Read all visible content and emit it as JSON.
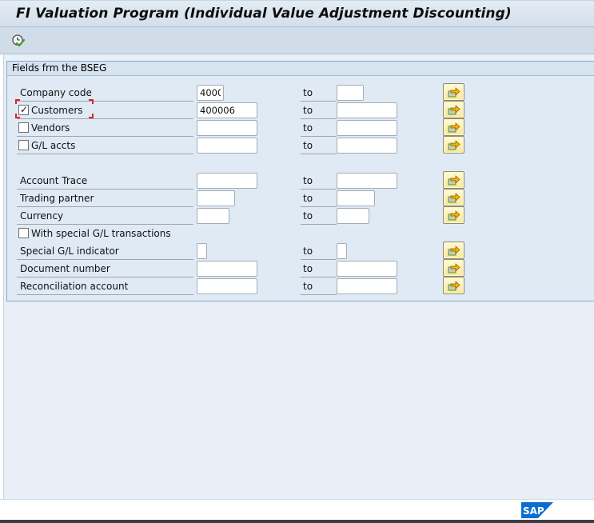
{
  "window": {
    "title": "FI Valuation Program (Individual Value Adjustment Discounting)"
  },
  "toolbar": {
    "execute_icon": "clock-check-icon",
    "execute_tooltip": "Execute"
  },
  "group": {
    "title": "Fields frm the BSEG",
    "to_label": "to",
    "rows": [
      {
        "label": "Company code",
        "type": "text",
        "from": "4000",
        "to": "",
        "checked": null
      },
      {
        "label": "Customers",
        "type": "checkbox",
        "from": "400006",
        "to": "",
        "checked": true,
        "focused": true
      },
      {
        "label": "Vendors",
        "type": "checkbox",
        "from": "",
        "to": "",
        "checked": false
      },
      {
        "label": "G/L accts",
        "type": "checkbox",
        "from": "",
        "to": "",
        "checked": false
      },
      {
        "label": "Account Trace",
        "type": "text",
        "from": "",
        "to": "",
        "checked": null
      },
      {
        "label": "Trading partner",
        "type": "text",
        "from": "",
        "to": "",
        "checked": null
      },
      {
        "label": "Currency",
        "type": "text",
        "from": "",
        "to": "",
        "checked": null
      },
      {
        "label": "With special G/L transactions",
        "type": "checkbox-only",
        "checked": false
      },
      {
        "label": "Special G/L indicator",
        "type": "text",
        "from": "",
        "to": "",
        "checked": null
      },
      {
        "label": "Document number",
        "type": "text",
        "from": "",
        "to": "",
        "checked": null
      },
      {
        "label": "Reconciliation account",
        "type": "text",
        "from": "",
        "to": "",
        "checked": null
      }
    ],
    "multiple_selection_icon": "multiple-selection-arrow-icon"
  },
  "footer": {
    "logo_text": "SAP",
    "logo_color": "#0a6ed1"
  },
  "colors": {
    "title_bg": "#d3dfeb",
    "content_bg": "#e8eff7",
    "group_bg": "#dfeaf5",
    "multisel_button": "#fbe89a",
    "focus_marker": "#d9262b"
  }
}
